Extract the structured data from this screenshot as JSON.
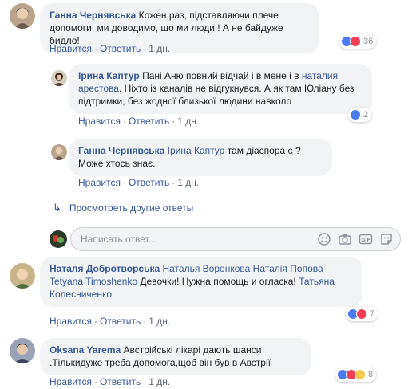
{
  "actions": {
    "like": "Нравится",
    "reply": "Ответить",
    "sep": "·"
  },
  "comments": [
    {
      "author": "Ганна Чернявська",
      "text": "Кожен раз, підставляючи плече допомоги, ми доводимо, що ми люди ! А не байдуже бидло!",
      "time": "1 дн.",
      "reactions": {
        "icons": [
          "like-icon",
          "love-icon"
        ],
        "count": "36"
      }
    },
    {
      "author": "Ірина Каптур",
      "text_before": "Пані Аню повний відчай і в мене і в",
      "mention": "наталия арестова",
      "text_after": ". Ніхто із каналів не відгукнувся. А як там Юліану без підтримки, без жодної близької людини навколо",
      "time": "1 дн.",
      "reactions": {
        "icons": [
          "like-icon"
        ],
        "count": "2"
      }
    },
    {
      "author": "Ганна Чернявська",
      "mention": "Ірина Каптур",
      "text": "там діаспора є ? Може хтось знає.",
      "time": "1 дн."
    },
    {
      "author": "Наталя Добротворська",
      "mentions": [
        "Наталья Воронкова",
        "Наталія Попова",
        "Tetyana Timoshenko"
      ],
      "text": "Девочки! Нужна помощь и огласка!",
      "mention_end": "Татьяна Колесниченко",
      "time": "1 дн.",
      "reactions": {
        "icons": [
          "like-icon",
          "love-icon"
        ],
        "count": "7"
      }
    },
    {
      "author": "Oksana Yarema",
      "text": "Австрійські лікарі дають шанси .Тількидуже треба допомога,щоб він був в Австрії",
      "time": "1 дн.",
      "reactions": {
        "icons": [
          "like-icon",
          "love-icon",
          "sad-icon"
        ],
        "count": "8"
      }
    }
  ],
  "more_replies": "Просмотреть другие ответы",
  "reply_input": {
    "placeholder": "Написать ответ..."
  },
  "colors": {
    "link": "#385898",
    "bubble": "#f2f3f5",
    "like": "#4b7bf0",
    "love": "#f33e58"
  }
}
